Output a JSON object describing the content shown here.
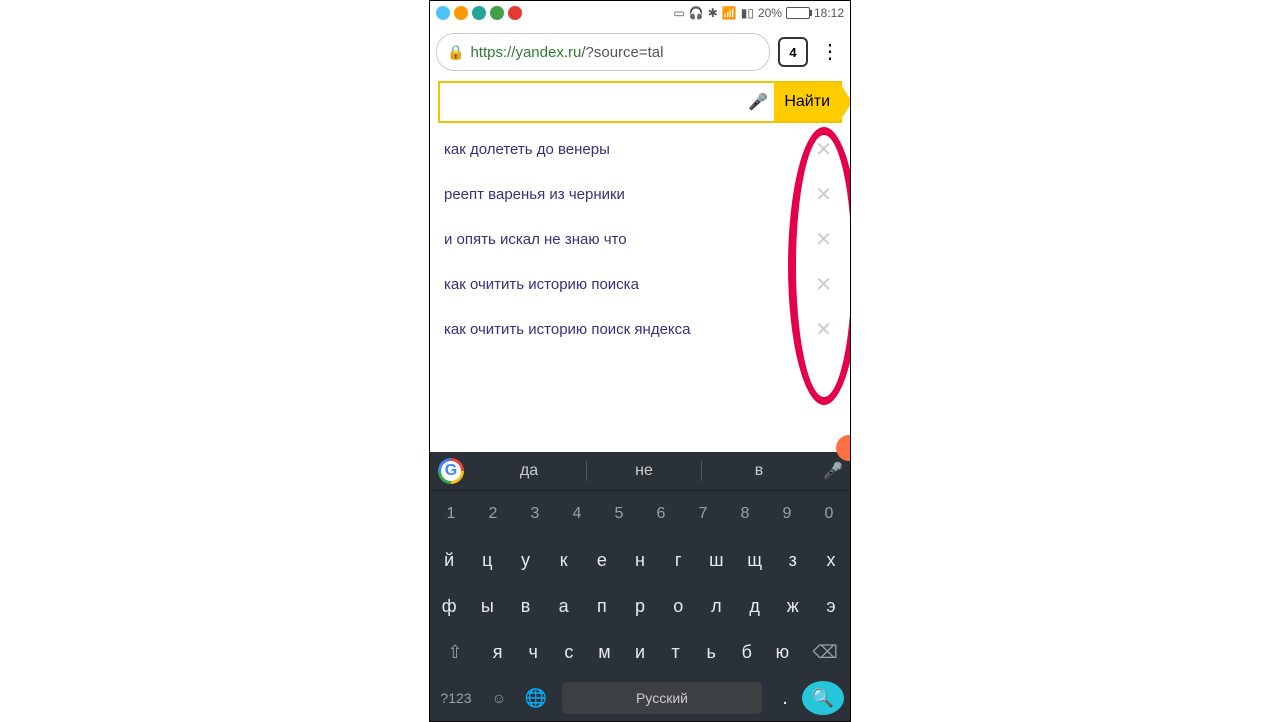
{
  "status": {
    "battery_pct": "20%",
    "time": "18:12"
  },
  "browser": {
    "url_host": "https://",
    "url_domain": "yandex.ru",
    "url_path": "/?source=tal",
    "tab_count": "4"
  },
  "search": {
    "button_label": "Найти",
    "input_value": ""
  },
  "suggestions": [
    "как долететь до венеры",
    "реепт варенья из черники",
    "и опять искал не знаю что",
    "как очитить историю поиска",
    "как очитить историю поиск яндекса"
  ],
  "keyboard": {
    "suggest_words": [
      "да",
      "не",
      "в"
    ],
    "row_numbers": [
      "1",
      "2",
      "3",
      "4",
      "5",
      "6",
      "7",
      "8",
      "9",
      "0"
    ],
    "row_top": [
      "й",
      "ц",
      "у",
      "к",
      "е",
      "н",
      "г",
      "ш",
      "щ",
      "з",
      "х"
    ],
    "row_mid": [
      "ф",
      "ы",
      "в",
      "а",
      "п",
      "р",
      "о",
      "л",
      "д",
      "ж",
      "э"
    ],
    "row_bot": [
      "я",
      "ч",
      "с",
      "м",
      "и",
      "т",
      "ь",
      "б",
      "ю"
    ],
    "symbols_key": "?123",
    "space_label": "Русский",
    "period": "."
  }
}
